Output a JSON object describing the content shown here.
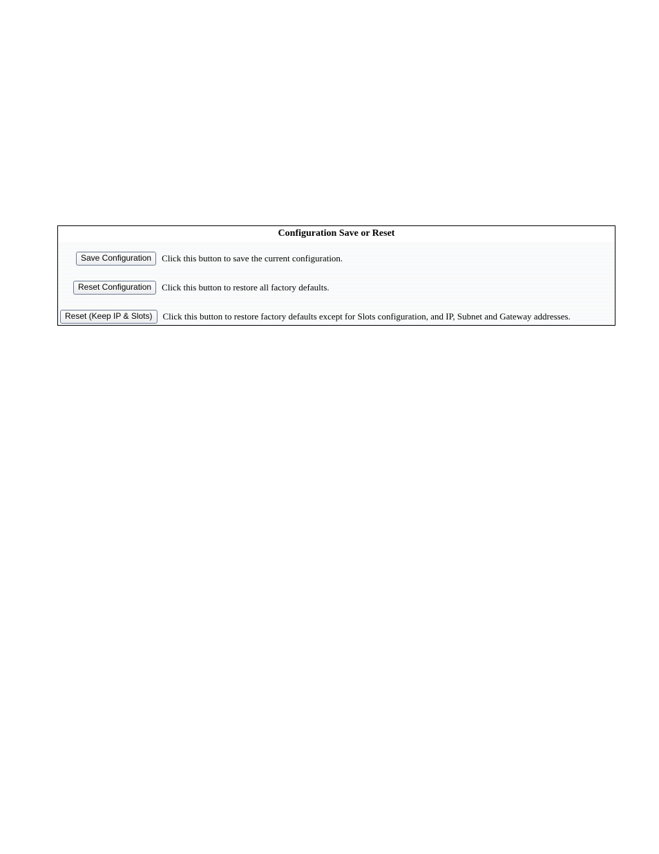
{
  "panel": {
    "title": "Configuration Save or Reset",
    "rows": [
      {
        "button_label": "Save Configuration",
        "description": "Click this button to save the current configuration."
      },
      {
        "button_label": "Reset Configuration",
        "description": "Click this button to restore all factory defaults."
      },
      {
        "button_label": "Reset (Keep IP & Slots)",
        "description": "Click this button to restore factory defaults except for Slots configuration, and IP, Subnet and Gateway addresses."
      }
    ]
  }
}
